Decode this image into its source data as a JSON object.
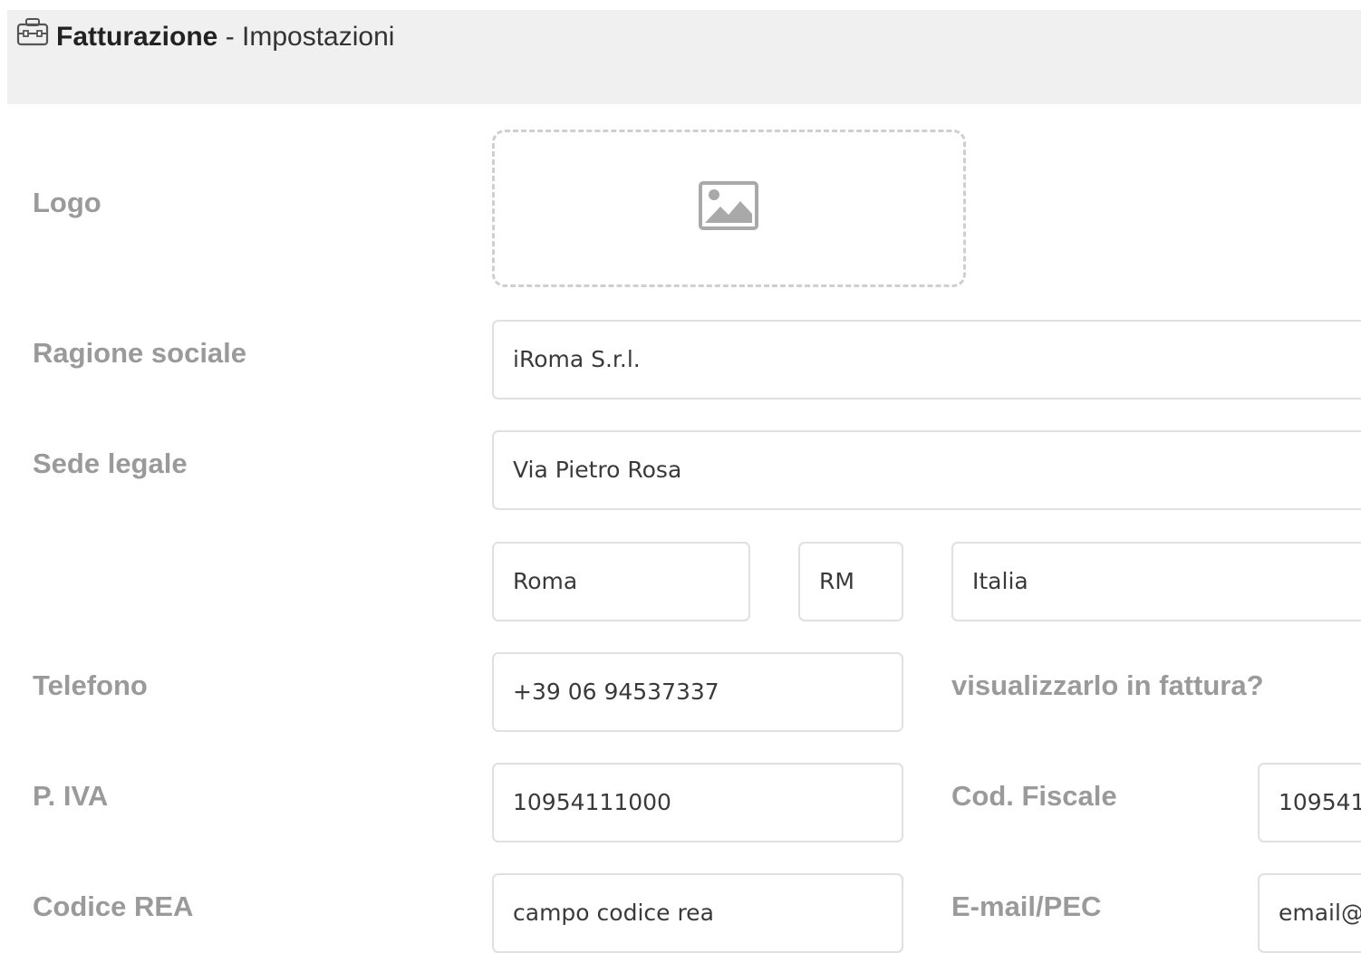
{
  "header": {
    "title_main": "Fatturazione",
    "title_sep": " - ",
    "title_sub": "Impostazioni",
    "icon": "toolbox-icon"
  },
  "form": {
    "logo": {
      "label": "Logo",
      "icon": "image-placeholder-icon"
    },
    "ragione_sociale": {
      "label": "Ragione sociale",
      "value": "iRoma S.r.l."
    },
    "sede_legale": {
      "label": "Sede legale",
      "via": "Via Pietro Rosa",
      "citta": "Roma",
      "provincia": "RM",
      "paese": "Italia"
    },
    "telefono": {
      "label": "Telefono",
      "value": "+39 06 94537337",
      "show_label": "visualizzarlo in fattura?"
    },
    "piva": {
      "label": "P. IVA",
      "value": "10954111000"
    },
    "cod_fiscale": {
      "label": "Cod. Fiscale",
      "value": "109541"
    },
    "codice_rea": {
      "label": "Codice REA",
      "value": "campo codice rea"
    },
    "email_pec": {
      "label": "E-mail/PEC",
      "value": "email@p"
    }
  },
  "colors": {
    "label": "#9a9a9a",
    "border": "#e0e0e0",
    "header_bg": "#f0f0f0"
  }
}
